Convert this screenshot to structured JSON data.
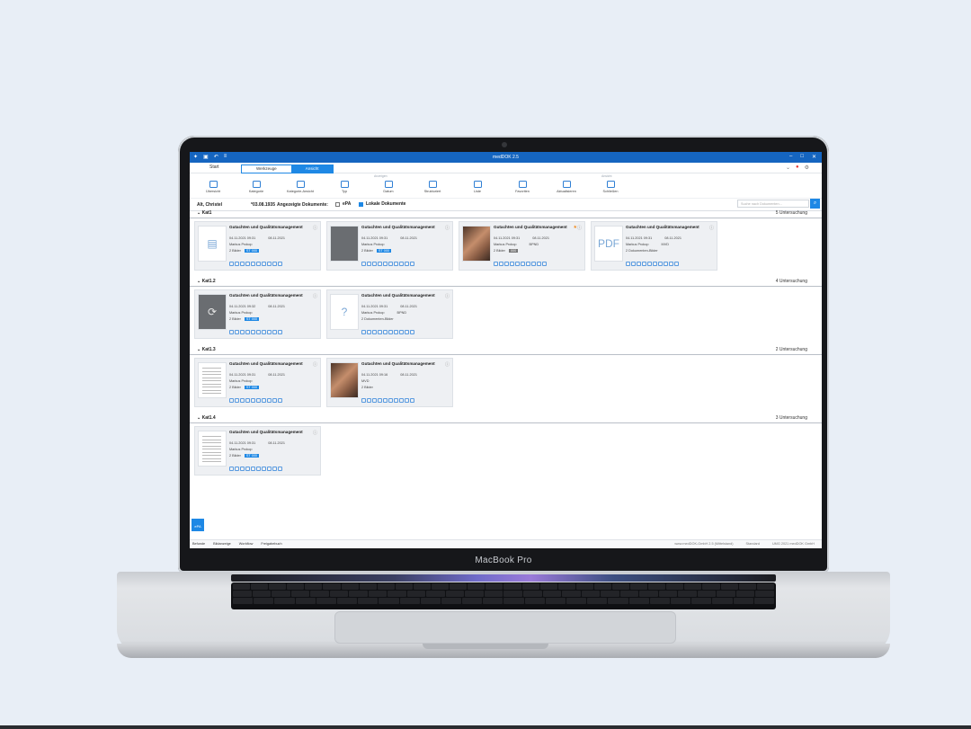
{
  "device": {
    "label": "MacBook Pro"
  },
  "app": {
    "title": "medDOK 2.5",
    "tabs": {
      "home": "Start",
      "segment_left": "Werkzeuge",
      "segment_right": "Ansicht"
    },
    "ribbon": {
      "group_labels": [
        "Anzeigen",
        "Ansicht"
      ],
      "buttons": [
        "Übersicht",
        "Kategorie",
        "Kategorie-Ansicht",
        "Typ",
        "Datum",
        "Strukturiert",
        "Liste",
        "Favoriten",
        "Aktualisieren",
        "Schließen"
      ]
    },
    "patient": {
      "name": "Alt, Christel",
      "dob": "*03.08.1935",
      "docs_label": "Angezeigte Dokumente:",
      "checkbox_epa": "ePA",
      "checkbox_local": "Lokale Dokumente",
      "search_placeholder": "Suche nach Dokumenten..."
    },
    "categories": [
      {
        "label": "Kat1",
        "count": "5 Untersuchung",
        "cards": [
          {
            "thumb": "doc",
            "title": "Gutachten und Qualitätsmanagement",
            "date1": "04.11.2021 09:31",
            "date2": "08.11.2021",
            "author": "Markus Prokop",
            "media": "2 Bilder",
            "tag": "ST 000",
            "favorite": false
          },
          {
            "thumb": "gray",
            "title": "Gutachten und Qualitätsmanagement",
            "date1": "04.11.2021 09:31",
            "date2": "08.11.2021",
            "author": "Markus Prokop",
            "media": "2 Bilder",
            "tag": "ST 000",
            "favorite": false
          },
          {
            "thumb": "photo",
            "title": "Gutachten und Qualitätsmanagement",
            "date1": "04.11.2021 09:31",
            "date2": "08.11.2021",
            "author": "Markus Prokop",
            "extra": "BPND",
            "media": "2 Bilder",
            "tag": "000",
            "favorite": true
          },
          {
            "thumb": "pdf",
            "title": "Gutachten und Qualitätsmanagement",
            "date1": "04.11.2021 09:31",
            "date2": "08.11.2021",
            "author": "Markus Prokop",
            "extra": "MVD",
            "media": "2 Dokumenten-Bilder",
            "tag": "",
            "favorite": false
          }
        ]
      },
      {
        "label": "Kat1.2",
        "count": "4 Untersuchung",
        "cards": [
          {
            "thumb": "sync",
            "title": "Gutachten und Qualitätsmanagement",
            "date1": "04.11.2021 09:32",
            "date2": "08.11.2021",
            "author": "Markus Prokop",
            "media": "2 Bilder",
            "tag": "ST 000",
            "favorite": false
          },
          {
            "thumb": "help",
            "title": "Gutachten und Qualitätsmanagement",
            "date1": "04.11.2021 09:31",
            "date2": "08.11.2021",
            "author": "Markus Prokop",
            "extra": "BPND",
            "media": "2 Dokumenten-Bilder",
            "tag": "",
            "favorite": false
          }
        ]
      },
      {
        "label": "Kat1.3",
        "count": "2 Untersuchung",
        "cards": [
          {
            "thumb": "paper",
            "title": "Gutachten und Qualitätsmanagement",
            "date1": "04.11.2021 09:31",
            "date2": "08.11.2021",
            "author": "Markus Prokop",
            "media": "2 Bilder",
            "tag": "ST 000",
            "favorite": false
          },
          {
            "thumb": "photo",
            "title": "Gutachten und Qualitätsmanagement",
            "date1": "04.11.2021 09:16",
            "date2": "08.11.2021",
            "author": "MVD",
            "media": "2 Bilder",
            "tag": "",
            "favorite": false
          }
        ]
      },
      {
        "label": "Kat1.4",
        "count": "3 Untersuchung",
        "cards": [
          {
            "thumb": "paper",
            "title": "Gutachten und Qualitätsmanagement",
            "date1": "04.11.2021 09:31",
            "date2": "08.11.2021",
            "author": "Markus Prokop",
            "media": "2 Bilder",
            "tag": "ST 000",
            "favorite": false
          }
        ]
      }
    ],
    "statusbar": {
      "left": [
        "Befunde",
        "Bildanzeige",
        "Workflow",
        "Freigabebuch"
      ],
      "right": [
        "www.medDOK-GmbH 2.5 (Mittelstand)",
        "Standard",
        "UMG 2021 medDOK GmbH"
      ]
    },
    "epa_badge": "ePA"
  },
  "colors": {
    "accent": "#1e88e5",
    "titlebar": "#1565c0",
    "favorite": "#f08a1c"
  }
}
